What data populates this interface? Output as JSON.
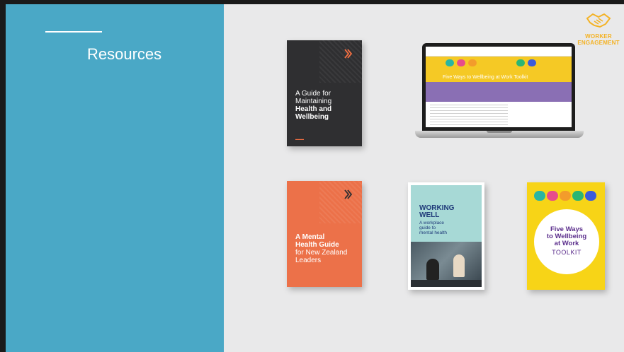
{
  "slide": {
    "title": "Resources"
  },
  "logo": {
    "line1": "WORKER",
    "line2": "ENGAGEMENT",
    "icon": "handshake-icon",
    "color": "#f4b223"
  },
  "colors": {
    "panel": "#4aa8c6",
    "background": "#e9e9ea",
    "orange": "#ec7149",
    "yellow": "#f7d417",
    "navy": "#1f3a79",
    "purple": "#5b2e8c"
  },
  "resources": {
    "dark_book": {
      "line1": "A Guide for",
      "line2": "Maintaining",
      "line3": "Health and",
      "line4": "Wellbeing"
    },
    "orange_book": {
      "line1": "A Mental",
      "line2": "Health Guide",
      "line3": "for New Zealand",
      "line4": "Leaders"
    },
    "working_well": {
      "title1": "WORKING",
      "title2": "WELL",
      "sub1": "A workplace",
      "sub2": "guide to",
      "sub3": "mental health"
    },
    "toolkit": {
      "line1": "Five Ways",
      "line2": "to Wellbeing",
      "line3": "at Work",
      "line4": "TOOLKIT"
    },
    "website": {
      "banner": "Five Ways to Wellbeing at Work Toolkit"
    }
  }
}
